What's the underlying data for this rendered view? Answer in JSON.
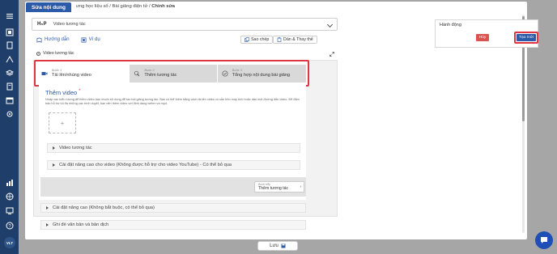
{
  "sidebar": {
    "user_initials": "VLT"
  },
  "breadcrumb": {
    "part1": "ưng học liệu số",
    "sep1": "/",
    "part2": "Bài giảng điện tử",
    "sep2": "/",
    "current": "Chỉnh sửa"
  },
  "modal": {
    "title": "Sửa nội dung"
  },
  "editor": {
    "selector": {
      "logo": "H₅P",
      "value": "Video tương tác"
    },
    "toolbar": {
      "guide": "Hướng dẫn",
      "example": "Ví dụ",
      "copy": "Sao chép",
      "paste": "Dán & Thay thế"
    },
    "section_label": "Video tương tác",
    "steps": [
      {
        "small": "Bước 1",
        "label": "Tải lên/nhúng video"
      },
      {
        "small": "Bước 2",
        "label": "Thêm tương tác"
      },
      {
        "small": "Bước 3",
        "label": "Tổng hợp nội dung bài giảng"
      }
    ],
    "add_video": {
      "title": "Thêm video",
      "required_mark": "*",
      "description": "Nhấp vào biểu tượng để thêm video bạn muốn sử dụng để tạo bài giảng tương tác. Bạn có thể thêm bằng cách tải lên video có sẵn trên máy tính hoặc dán một đường dẫn video. Để đảm bảo hỗ trợ tối đa những các trình duyệt, bạn nên thêm video với định dạng webm và mp4.",
      "add_symbol": "+"
    },
    "accordions": {
      "video": "Video tương tác",
      "advanced_video": "Cài đặt nâng cao cho video (Không được hỗ trợ cho video YouTube) - Có thể bỏ qua",
      "advanced": "Cài đặt nâng cao (Không bắt buộc, có thể bỏ qua)",
      "override": "Ghi đè văn bản và bản dịch"
    },
    "next": {
      "small": "Bước tiếp",
      "label": "Thêm tương tác",
      "arrow": "›"
    }
  },
  "actions": {
    "title": "Hành động",
    "cancel": "Hủy",
    "create": "Tạo mới"
  },
  "footer": {
    "save": "Lưu"
  }
}
